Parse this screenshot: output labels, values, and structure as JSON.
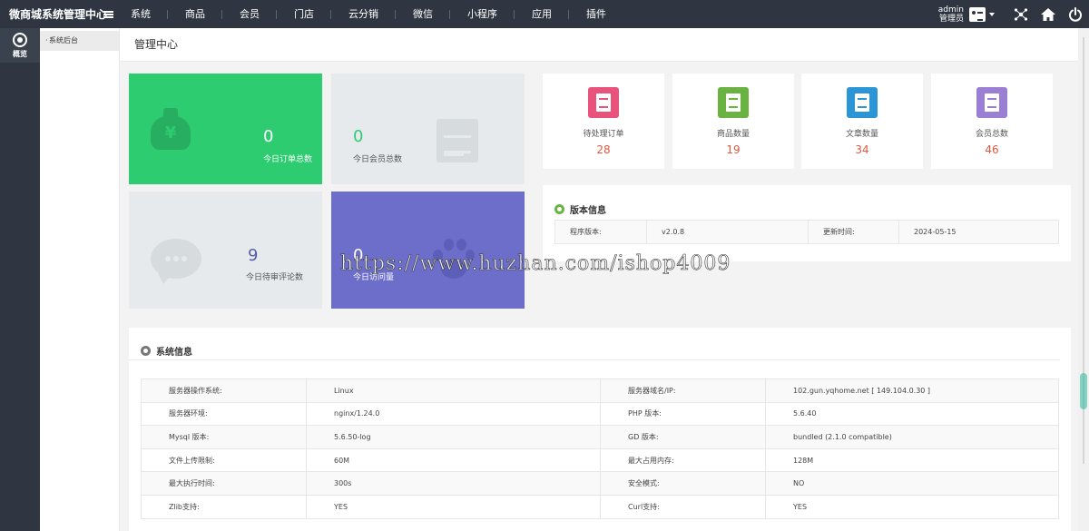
{
  "app": {
    "brand": "微商城系统管理中心"
  },
  "nav": [
    "系统",
    "商品",
    "会员",
    "门店",
    "云分销",
    "微信",
    "小程序",
    "应用",
    "插件"
  ],
  "user": {
    "name": "admin",
    "role": "管理员"
  },
  "rail": {
    "label": "概览"
  },
  "sidebar": {
    "item": "系统后台"
  },
  "page": {
    "title": "管理中心"
  },
  "tiles": [
    {
      "value": "0",
      "label": "今日订单总数",
      "icon": "money-bag-icon",
      "color": "#2ecc71"
    },
    {
      "value": "0",
      "label": "今日会员总数",
      "icon": "document-icon",
      "color": "#e6eaec"
    },
    {
      "value": "9",
      "label": "今日待审评论数",
      "icon": "chat-icon",
      "color": "#e6eaec"
    },
    {
      "value": "0",
      "label": "今日访问量",
      "icon": "paw-icon",
      "color": "#6d6ec9"
    }
  ],
  "stats": [
    {
      "label": "待处理订单",
      "value": "28",
      "icon": "order-icon",
      "color": "#e9537b"
    },
    {
      "label": "商品数量",
      "value": "19",
      "icon": "notebook-icon",
      "color": "#6ab342"
    },
    {
      "label": "文章数量",
      "value": "34",
      "icon": "clipboard-icon",
      "color": "#2b95d6"
    },
    {
      "label": "会员总数",
      "value": "46",
      "icon": "truck-icon",
      "color": "#9b7fd4"
    }
  ],
  "version": {
    "title": "版本信息",
    "program_label": "程序版本:",
    "program_value": "v2.0.8",
    "updated_label": "更新时间:",
    "updated_value": "2024-05-15"
  },
  "system": {
    "title": "系统信息",
    "rows": [
      [
        "服务器操作系统:",
        "Linux",
        "服务器域名/IP:",
        "102.gun.yqhome.net [ 149.104.0.30 ]"
      ],
      [
        "服务器环境:",
        "nginx/1.24.0",
        "PHP 版本:",
        "5.6.40"
      ],
      [
        "Mysql 版本:",
        "5.6.50-log",
        "GD 版本:",
        "bundled (2.1.0 compatible)"
      ],
      [
        "文件上传限制:",
        "60M",
        "最大占用内存:",
        "128M"
      ],
      [
        "最大执行时间:",
        "300s",
        "安全模式:",
        "NO"
      ],
      [
        "Zlib支持:",
        "YES",
        "Curl支持:",
        "YES"
      ]
    ]
  },
  "watermark": "https://www.huzhan.com/ishop4009"
}
